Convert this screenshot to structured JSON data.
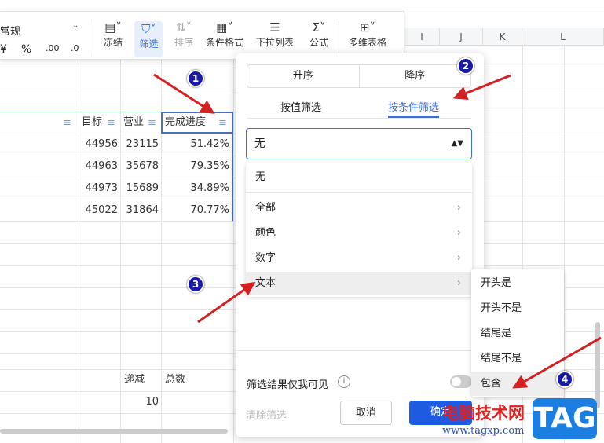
{
  "toolbar": {
    "number_format": "常规",
    "currency": "¥",
    "percent": "%",
    "inc_decimal": ".00",
    "dec_decimal": ".0",
    "items": [
      {
        "label": "冻结",
        "icon": "freeze-icon"
      },
      {
        "label": "筛选",
        "icon": "filter-icon"
      },
      {
        "label": "排序",
        "icon": "sort-icon"
      },
      {
        "label": "条件格式",
        "icon": "conditional-format-icon"
      },
      {
        "label": "下拉列表",
        "icon": "dropdown-list-icon"
      },
      {
        "label": "公式",
        "icon": "sigma-icon"
      },
      {
        "label": "多维表格",
        "icon": "multi-table-icon"
      }
    ]
  },
  "columns": [
    "I",
    "J",
    "K",
    "L"
  ],
  "table": {
    "headers": [
      "目标",
      "营业",
      "完成进度"
    ],
    "rows": [
      [
        "44956",
        "23115",
        "51.42%"
      ],
      [
        "44963",
        "35678",
        "79.35%"
      ],
      [
        "44973",
        "15689",
        "34.89%"
      ],
      [
        "45022",
        "31864",
        "70.77%"
      ]
    ],
    "extra_headers": [
      "递减",
      "总数"
    ],
    "extra_value": "10"
  },
  "panel": {
    "sort_asc": "升序",
    "sort_desc": "降序",
    "tab_value": "按值筛选",
    "tab_condition": "按条件筛选",
    "selected": "无",
    "options": [
      {
        "label": "无"
      },
      {
        "label": "全部"
      },
      {
        "label": "颜色"
      },
      {
        "label": "数字"
      },
      {
        "label": "文本"
      }
    ],
    "text_options": [
      "开头是",
      "开头不是",
      "结尾是",
      "结尾不是",
      "包含"
    ],
    "visible_only_me": "筛选结果仅我可见",
    "toggle_on": false,
    "clear": "清除筛选",
    "cancel": "取消",
    "confirm": "确定"
  },
  "annotations": [
    "1",
    "2",
    "3",
    "4"
  ],
  "watermark": {
    "text": "电脑技术网",
    "url": "www.tagxp.com",
    "logo": "TAG"
  },
  "colors": {
    "accent": "#3a6ee8",
    "arrow": "#d42020",
    "badge": "#1a1aa8"
  }
}
